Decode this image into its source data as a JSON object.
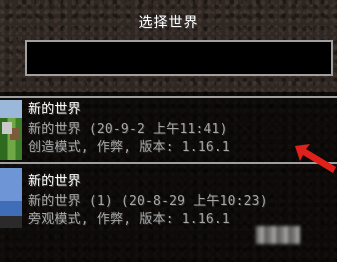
{
  "screen": {
    "title": "选择世界"
  },
  "search": {
    "value": "",
    "placeholder": ""
  },
  "worlds": [
    {
      "name": "新的世界",
      "detail": "新的世界 (20-9-2 上午11:41)",
      "info": "创造模式, 作弊, 版本: 1.16.1",
      "selected": true,
      "thumbnail": "grass-landscape"
    },
    {
      "name": "新的世界",
      "detail": "新的世界 (1) (20-8-29 上午10:23)",
      "info": "旁观模式, 作弊, 版本: 1.16.1",
      "selected": false,
      "thumbnail": "sky-landscape"
    }
  ],
  "annotation": {
    "arrow_color": "#e0201a",
    "arrow_icon": "red-arrow-icon"
  }
}
